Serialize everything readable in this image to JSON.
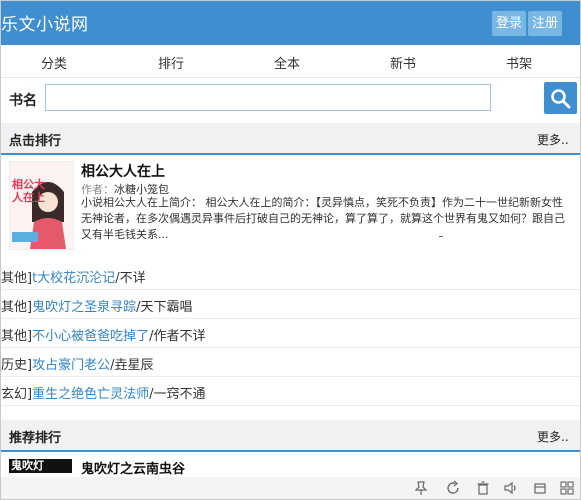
{
  "header": {
    "logo": "乐文小说网",
    "login": "登录",
    "register": "注册"
  },
  "nav": [
    "分类",
    "排行",
    "全本",
    "新书",
    "书架"
  ],
  "search": {
    "label": "书名",
    "value": "",
    "placeholder": ""
  },
  "click_rank": {
    "title": "点击排行",
    "more": "更多..",
    "featured": {
      "title": "相公大人在上",
      "author_label": "作者：",
      "author": "冰糖小笼包",
      "intro": "小说相公大人在上简介： 相公大人在上的简介：【灵异慎点，笑死不负责】作为二十一世纪新新女性无神论者，在多次偶遇灵异事件后打破自己的无神论，算了算了，就算这个世界有鬼又如何？跟自己又有半毛钱关系...",
      "cover_text": "相公大人在上"
    },
    "items": [
      {
        "cat": "其他]",
        "title": "t大校花沉沦记",
        "sep": "/",
        "author": "不详"
      },
      {
        "cat": "其他]",
        "title": "鬼吹灯之圣泉寻踪",
        "sep": "/",
        "author": "天下霸唱"
      },
      {
        "cat": "其他]",
        "title": "不小心被爸爸吃掉了",
        "sep": "/",
        "author": "作者不详"
      },
      {
        "cat": "历史]",
        "title": "攻占豪门老公",
        "sep": "/",
        "author": "垚星辰"
      },
      {
        "cat": "玄幻]",
        "title": "重生之绝色亡灵法师",
        "sep": "/",
        "author": "一窍不通"
      }
    ]
  },
  "recommend_rank": {
    "title": "推荐排行",
    "more": "更多..",
    "first": {
      "cover_text": "鬼吹灯",
      "title": "鬼吹灯之云南虫谷"
    }
  },
  "colors": {
    "accent": "#3f8fd0",
    "link": "#3385c6"
  }
}
